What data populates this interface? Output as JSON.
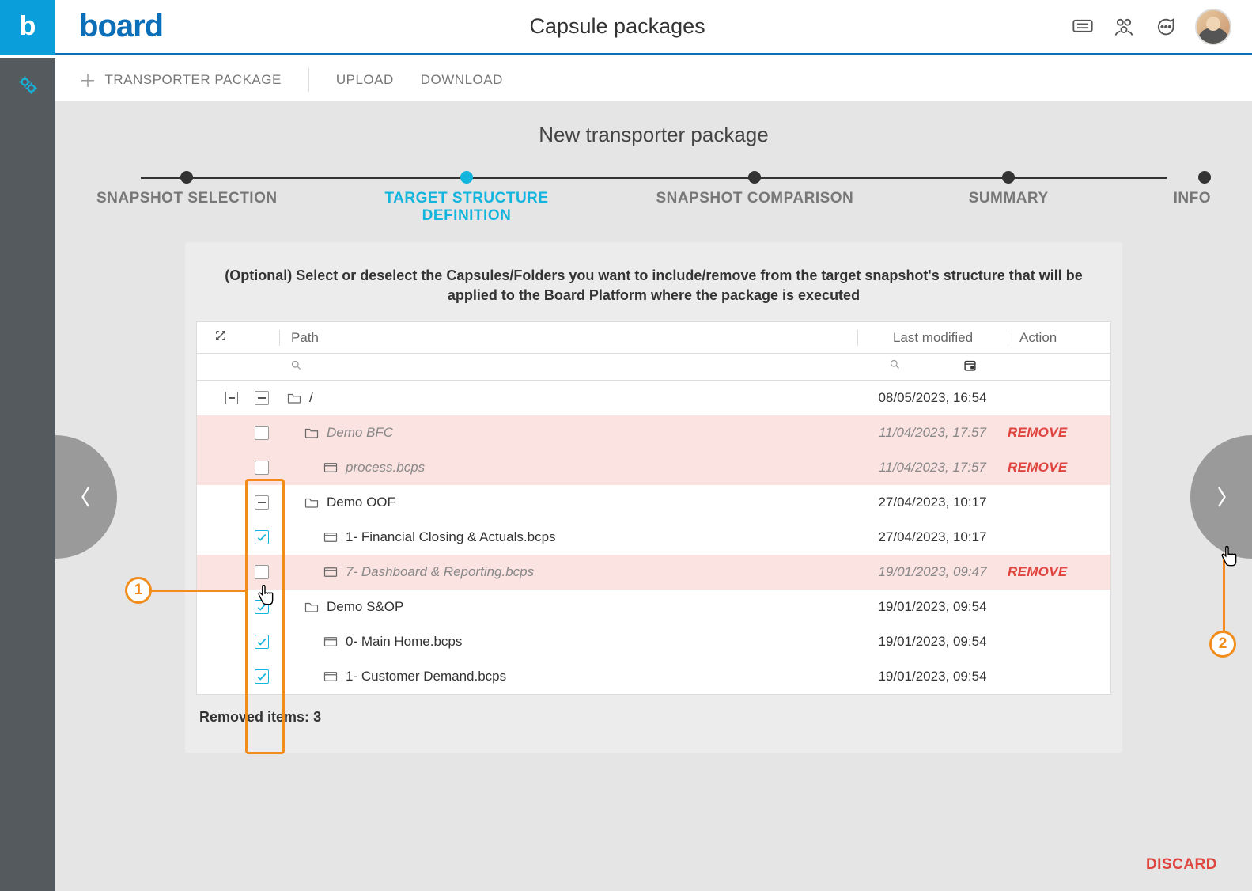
{
  "header": {
    "title": "Capsule packages",
    "logo_text": "board"
  },
  "toolbar": {
    "transporter": "TRANSPORTER PACKAGE",
    "upload": "UPLOAD",
    "download": "DOWNLOAD"
  },
  "page": {
    "title": "New transporter package",
    "description": "(Optional) Select or deselect the Capsules/Folders you want to include/remove from the target snapshot's structure that will be applied to the Board Platform where the package is executed",
    "removed_label": "Removed items:",
    "removed_count": "3",
    "discard": "DISCARD"
  },
  "stepper": {
    "steps": [
      {
        "label": "SNAPSHOT SELECTION",
        "active": false
      },
      {
        "label": "TARGET STRUCTURE\nDEFINITION",
        "active": true
      },
      {
        "label": "SNAPSHOT COMPARISON",
        "active": false
      },
      {
        "label": "SUMMARY",
        "active": false
      },
      {
        "label": "INFO",
        "active": false
      }
    ]
  },
  "table": {
    "cols": {
      "path": "Path",
      "modified": "Last modified",
      "action": "Action"
    },
    "rows": [
      {
        "indent": 0,
        "check": "indeterminate",
        "type": "folder",
        "expand": true,
        "name": "/",
        "modified": "08/05/2023, 16:54",
        "action": "",
        "removed": false
      },
      {
        "indent": 1,
        "check": "unchecked",
        "type": "folder",
        "name": "Demo BFC",
        "modified": "11/04/2023, 17:57",
        "action": "REMOVE",
        "removed": true
      },
      {
        "indent": 2,
        "check": "unchecked",
        "type": "file",
        "name": "process.bcps",
        "modified": "11/04/2023, 17:57",
        "action": "REMOVE",
        "removed": true
      },
      {
        "indent": 1,
        "check": "indeterminate",
        "type": "folder",
        "name": "Demo OOF",
        "modified": "27/04/2023, 10:17",
        "action": "",
        "removed": false
      },
      {
        "indent": 2,
        "check": "checked",
        "type": "file",
        "name": "1- Financial Closing & Actuals.bcps",
        "modified": "27/04/2023, 10:17",
        "action": "",
        "removed": false
      },
      {
        "indent": 2,
        "check": "unchecked",
        "type": "file",
        "name": "7- Dashboard & Reporting.bcps",
        "modified": "19/01/2023, 09:47",
        "action": "REMOVE",
        "removed": true
      },
      {
        "indent": 1,
        "check": "checked",
        "type": "folder",
        "name": "Demo S&OP",
        "modified": "19/01/2023, 09:54",
        "action": "",
        "removed": false
      },
      {
        "indent": 2,
        "check": "checked",
        "type": "file",
        "name": "0- Main Home.bcps",
        "modified": "19/01/2023, 09:54",
        "action": "",
        "removed": false
      },
      {
        "indent": 2,
        "check": "checked",
        "type": "file",
        "name": "1- Customer Demand.bcps",
        "modified": "19/01/2023, 09:54",
        "action": "",
        "removed": false
      }
    ]
  },
  "callouts": {
    "one": "1",
    "two": "2"
  }
}
